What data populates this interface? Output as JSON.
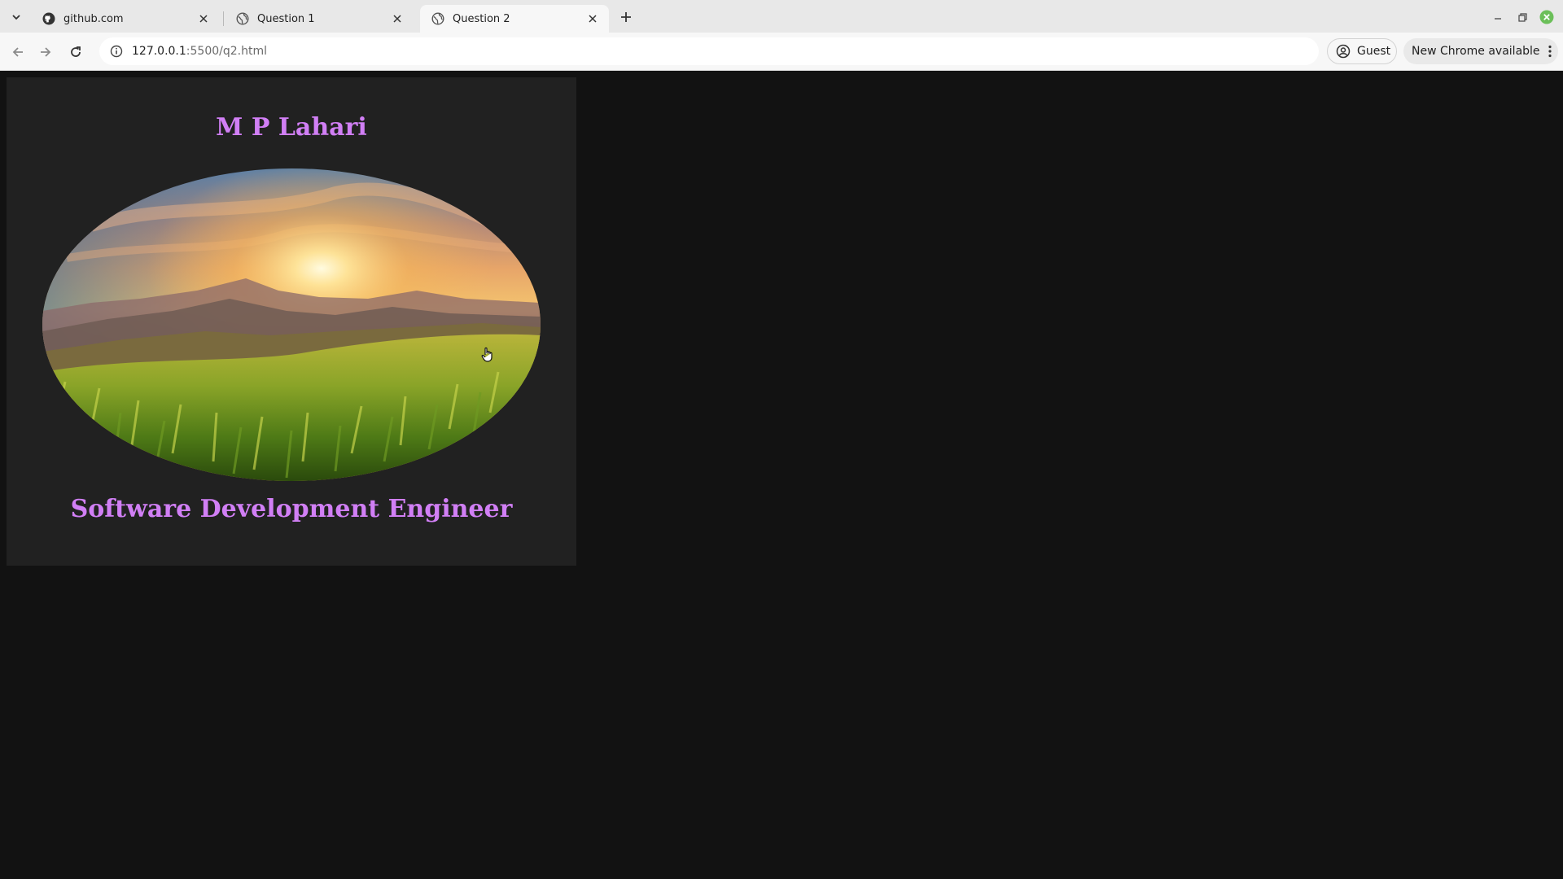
{
  "browser": {
    "tabs": [
      {
        "title": "github.com",
        "favicon": "github-icon"
      },
      {
        "title": "Question 1",
        "favicon": "globe-icon"
      },
      {
        "title": "Question 2",
        "favicon": "globe-icon",
        "active": true
      }
    ],
    "url_host": "127.0.0.1",
    "url_path": ":5500/q2.html",
    "profile_label": "Guest",
    "update_label": "New Chrome available"
  },
  "page": {
    "name": "M P Lahari",
    "role": "Software Development Engineer",
    "image": "sunrise-over-grassy-mountains",
    "heading_color": "#d17ff5",
    "card_color": "#212121",
    "background_color": "#121212"
  }
}
